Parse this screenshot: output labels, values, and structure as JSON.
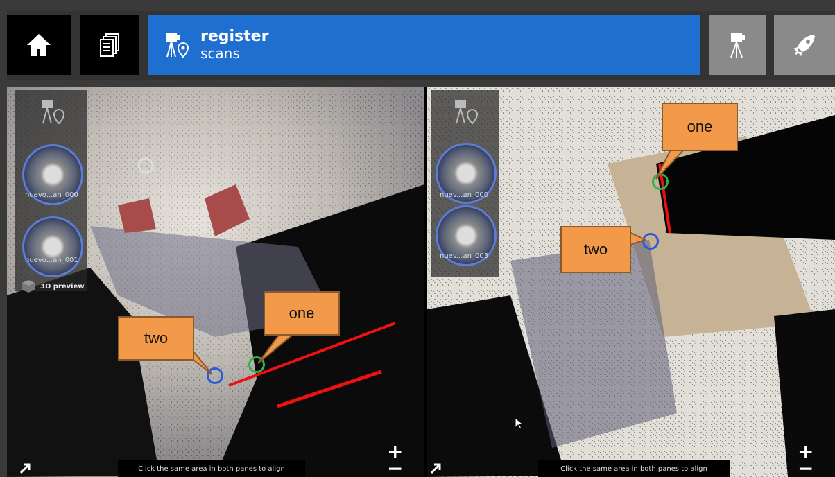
{
  "header": {
    "title": "register",
    "subtitle": "scans",
    "buttons": [
      {
        "name": "home-button",
        "icon": "home-icon"
      },
      {
        "name": "projects-button",
        "icon": "documents-icon"
      },
      {
        "name": "scanner-button",
        "icon": "scanner-tripod-icon"
      },
      {
        "name": "launch-button",
        "icon": "rocket-icon"
      }
    ]
  },
  "left_pane": {
    "thumbnails": [
      {
        "label": "nuevo...an_000"
      },
      {
        "label": "nuevo...an_001"
      }
    ],
    "preview_label": "3D preview",
    "hint": "Click the same area in both panes to align",
    "callouts": [
      {
        "label": "one"
      },
      {
        "label": "two"
      }
    ]
  },
  "right_pane": {
    "thumbnails": [
      {
        "label": "nuev...an_000"
      },
      {
        "label": "nuev...an_003"
      }
    ],
    "hint": "Click the same area in both panes to align",
    "callouts": [
      {
        "label": "one"
      },
      {
        "label": "two"
      }
    ]
  },
  "zoom": {
    "plus": "+",
    "minus": "−"
  },
  "colors": {
    "accent": "#1f6fd1",
    "callout": "#f2994a",
    "marker_one": "#2db34a",
    "marker_two": "#2a5bd6"
  }
}
